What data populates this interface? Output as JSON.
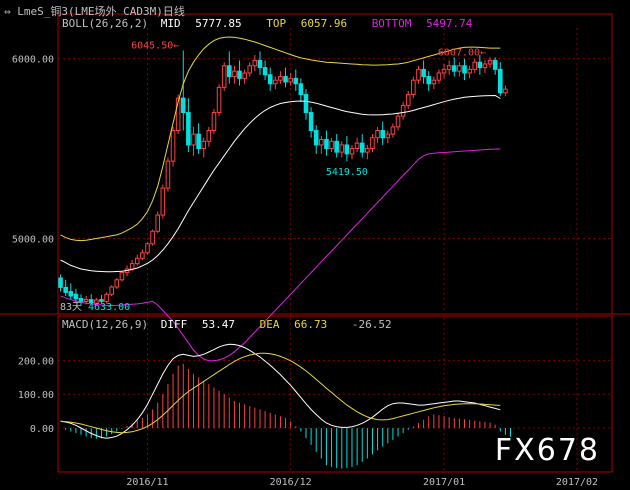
{
  "window": {
    "title": "LmeS_铜3(LME场外 CAD3M)日线",
    "title_color": "#c0c0c0"
  },
  "indicators": {
    "boll": {
      "label": "BOLL(26,26,2)",
      "mid_label": "MID",
      "mid_value": "5777.85",
      "top_label": "TOP",
      "top_value": "6057.96",
      "bottom_label": "BOTTOM",
      "bottom_value": "5497.74"
    },
    "macd": {
      "label": "MACD(12,26,9)",
      "diff_label": "DIFF",
      "diff_value": "53.47",
      "dea_label": "DEA",
      "dea_value": "66.73",
      "macd_value": "-26.52"
    }
  },
  "colors": {
    "up": "#ff4040",
    "down": "#00e0e0",
    "mid": "#ffffff",
    "top": "#e6d83c",
    "bottom": "#e020e0",
    "grid": "#800000",
    "axis": "#b00000",
    "text": "#c0c0c0",
    "annot": "#ff4040",
    "diff": "#ffffff",
    "dea": "#e6d83c"
  },
  "annotations": {
    "high1": "6045.50",
    "high2": "6007.00",
    "low": "5419.50",
    "left_low": "4633.00",
    "day_count": "83天"
  },
  "watermark": "FX678",
  "chart_data": [
    {
      "type": "candlestick",
      "title": "LmeS_铜3(LME场外 CAD3M)日线",
      "y_ticks": [
        "6000.00",
        "5000.00"
      ],
      "y_tick_values": [
        6000,
        5000
      ],
      "ylim": [
        4580,
        6170
      ],
      "x_ticks": [
        "2016/11",
        "2016/12",
        "2017/01",
        "2017/02"
      ],
      "x_tick_index": [
        17,
        45,
        75,
        101
      ],
      "n_bars": 106,
      "candles": [
        [
          4780,
          4800,
          4728,
          4705
        ],
        [
          4728,
          4770,
          4700,
          4680
        ],
        [
          4705,
          4750,
          4680,
          4660
        ],
        [
          4690,
          4720,
          4664,
          4640
        ],
        [
          4666,
          4690,
          4650,
          4630
        ],
        [
          4650,
          4680,
          4661,
          4634
        ],
        [
          4660,
          4690,
          4643,
          4635
        ],
        [
          4640,
          4670,
          4658,
          4633
        ],
        [
          4660,
          4686,
          4650,
          4640
        ],
        [
          4650,
          4700,
          4690,
          4640
        ],
        [
          4690,
          4740,
          4730,
          4680
        ],
        [
          4730,
          4780,
          4770,
          4720
        ],
        [
          4770,
          4820,
          4810,
          4760
        ],
        [
          4810,
          4850,
          4830,
          4790
        ],
        [
          4830,
          4880,
          4860,
          4820
        ],
        [
          4860,
          4910,
          4890,
          4850
        ],
        [
          4890,
          4940,
          4920,
          4880
        ],
        [
          4920,
          4980,
          4970,
          4910
        ],
        [
          4970,
          5050,
          5040,
          4960
        ],
        [
          5040,
          5150,
          5130,
          5030
        ],
        [
          5130,
          5300,
          5280,
          5110
        ],
        [
          5280,
          5450,
          5430,
          5260
        ],
        [
          5430,
          5620,
          5600,
          5400
        ],
        [
          5600,
          5800,
          5780,
          5580
        ],
        [
          5780,
          6045,
          5700,
          5600
        ],
        [
          5700,
          5780,
          5520,
          5480
        ],
        [
          5520,
          5620,
          5580,
          5460
        ],
        [
          5580,
          5640,
          5500,
          5470
        ],
        [
          5500,
          5560,
          5540,
          5450
        ],
        [
          5540,
          5620,
          5600,
          5510
        ],
        [
          5600,
          5720,
          5700,
          5580
        ],
        [
          5700,
          5860,
          5840,
          5680
        ],
        [
          5840,
          5980,
          5960,
          5820
        ],
        [
          5960,
          6040,
          5900,
          5860
        ],
        [
          5900,
          5960,
          5930,
          5860
        ],
        [
          5930,
          5990,
          5890,
          5850
        ],
        [
          5890,
          5940,
          5920,
          5860
        ],
        [
          5920,
          5980,
          5960,
          5900
        ],
        [
          5960,
          6020,
          5990,
          5930
        ],
        [
          5990,
          6040,
          5950,
          5910
        ],
        [
          5950,
          5990,
          5910,
          5880
        ],
        [
          5910,
          5950,
          5860,
          5820
        ],
        [
          5860,
          5900,
          5880,
          5830
        ],
        [
          5880,
          5930,
          5900,
          5860
        ],
        [
          5900,
          5950,
          5870,
          5840
        ],
        [
          5870,
          5920,
          5890,
          5850
        ],
        [
          5890,
          5940,
          5860,
          5820
        ],
        [
          5860,
          5890,
          5800,
          5760
        ],
        [
          5800,
          5830,
          5700,
          5660
        ],
        [
          5700,
          5730,
          5600,
          5560
        ],
        [
          5600,
          5630,
          5520,
          5470
        ],
        [
          5520,
          5570,
          5550,
          5470
        ],
        [
          5550,
          5600,
          5500,
          5460
        ],
        [
          5500,
          5560,
          5540,
          5480
        ],
        [
          5540,
          5580,
          5480,
          5450
        ],
        [
          5480,
          5540,
          5520,
          5450
        ],
        [
          5520,
          5570,
          5470,
          5430
        ],
        [
          5470,
          5520,
          5500,
          5440
        ],
        [
          5500,
          5560,
          5530,
          5480
        ],
        [
          5530,
          5580,
          5480,
          5450
        ],
        [
          5480,
          5520,
          5500,
          5440
        ],
        [
          5500,
          5580,
          5560,
          5480
        ],
        [
          5560,
          5620,
          5600,
          5530
        ],
        [
          5600,
          5650,
          5560,
          5520
        ],
        [
          5560,
          5600,
          5580,
          5530
        ],
        [
          5580,
          5640,
          5620,
          5560
        ],
        [
          5620,
          5700,
          5680,
          5600
        ],
        [
          5680,
          5760,
          5740,
          5660
        ],
        [
          5740,
          5820,
          5800,
          5720
        ],
        [
          5800,
          5900,
          5880,
          5780
        ],
        [
          5880,
          5960,
          5940,
          5860
        ],
        [
          5940,
          5990,
          5900,
          5860
        ],
        [
          5900,
          5930,
          5860,
          5820
        ],
        [
          5860,
          5900,
          5880,
          5830
        ],
        [
          5880,
          5940,
          5920,
          5860
        ],
        [
          5920,
          5970,
          5940,
          5890
        ],
        [
          5940,
          5990,
          5960,
          5910
        ],
        [
          5960,
          6007,
          5930,
          5900
        ],
        [
          5930,
          5980,
          5960,
          5900
        ],
        [
          5960,
          6000,
          5920,
          5880
        ],
        [
          5920,
          5960,
          5940,
          5890
        ],
        [
          5940,
          6000,
          5980,
          5920
        ],
        [
          5980,
          6020,
          5950,
          5910
        ],
        [
          5950,
          5990,
          5970,
          5920
        ],
        [
          5970,
          6007,
          5990,
          5950
        ],
        [
          5990,
          6007,
          5940,
          5910
        ],
        [
          5940,
          5980,
          5810,
          5790
        ],
        [
          5810,
          5850,
          5830,
          5790
        ]
      ],
      "series": [
        {
          "name": "MID",
          "color_key": "mid",
          "values": [
            4880,
            4865,
            4850,
            4840,
            4830,
            4825,
            4820,
            4818,
            4816,
            4815,
            4815,
            4816,
            4818,
            4822,
            4828,
            4836,
            4848,
            4862,
            4880,
            4905,
            4935,
            4970,
            5010,
            5055,
            5105,
            5155,
            5200,
            5245,
            5290,
            5335,
            5380,
            5420,
            5460,
            5500,
            5540,
            5575,
            5610,
            5640,
            5668,
            5692,
            5712,
            5728,
            5740,
            5750,
            5756,
            5760,
            5763,
            5764,
            5762,
            5758,
            5752,
            5744,
            5736,
            5728,
            5720,
            5712,
            5705,
            5700,
            5695,
            5690,
            5688,
            5687,
            5687,
            5688,
            5690,
            5692,
            5696,
            5700,
            5705,
            5712,
            5720,
            5728,
            5736,
            5744,
            5752,
            5760,
            5768,
            5775,
            5780,
            5785,
            5788,
            5790,
            5792,
            5793,
            5794,
            5795,
            5778
          ]
        },
        {
          "name": "TOP",
          "color_key": "top",
          "values": [
            5020,
            5005,
            4995,
            4990,
            4988,
            4990,
            4995,
            5000,
            5005,
            5010,
            5015,
            5020,
            5030,
            5045,
            5060,
            5080,
            5110,
            5150,
            5210,
            5290,
            5400,
            5520,
            5640,
            5760,
            5860,
            5930,
            5980,
            6020,
            6055,
            6080,
            6100,
            6112,
            6118,
            6120,
            6118,
            6114,
            6108,
            6100,
            6092,
            6082,
            6072,
            6062,
            6052,
            6042,
            6032,
            6022,
            6012,
            6004,
            5998,
            5992,
            5988,
            5984,
            5980,
            5978,
            5976,
            5974,
            5972,
            5970,
            5968,
            5966,
            5965,
            5964,
            5964,
            5965,
            5966,
            5968,
            5970,
            5974,
            5980,
            5988,
            5996,
            6004,
            6012,
            6020,
            6028,
            6036,
            6044,
            6052,
            6058,
            6062,
            6064,
            6064,
            6062,
            6060,
            6058,
            6058,
            6058
          ]
        },
        {
          "name": "BOTTOM",
          "color_key": "bottom",
          "values": [
            4680,
            4670,
            4660,
            4652,
            4645,
            4640,
            4636,
            4633,
            4630,
            4628,
            4627,
            4628,
            4630,
            4632,
            4634,
            4636,
            4640,
            4645,
            4650,
            4630,
            4600,
            4570,
            4540,
            4500,
            4460,
            4420,
            4380,
            4350,
            4330,
            4320,
            4320,
            4325,
            4335,
            4350,
            4370,
            4395,
            4420,
            4450,
            4480,
            4510,
            4540,
            4570,
            4600,
            4630,
            4660,
            4690,
            4720,
            4750,
            4780,
            4810,
            4840,
            4870,
            4900,
            4930,
            4960,
            4990,
            5020,
            5050,
            5080,
            5110,
            5140,
            5170,
            5200,
            5230,
            5260,
            5290,
            5320,
            5350,
            5380,
            5410,
            5440,
            5460,
            5470,
            5474,
            5476,
            5478,
            5480,
            5482,
            5484,
            5486,
            5488,
            5490,
            5492,
            5494,
            5496,
            5497,
            5498
          ]
        }
      ]
    },
    {
      "type": "bar+line",
      "title": "MACD(12,26,9)",
      "y_ticks": [
        "200.00",
        "100.00",
        "0.00"
      ],
      "y_tick_values": [
        200,
        100,
        0
      ],
      "ylim": [
        -130,
        290
      ],
      "n_bars": 106,
      "macd_values": [
        0,
        -5,
        -10,
        -15,
        -20,
        -25,
        -30,
        -32,
        -30,
        -25,
        -18,
        -10,
        -2,
        6,
        14,
        22,
        30,
        40,
        55,
        75,
        100,
        130,
        160,
        185,
        190,
        175,
        160,
        150,
        140,
        130,
        120,
        110,
        100,
        90,
        80,
        75,
        70,
        65,
        60,
        55,
        50,
        45,
        40,
        35,
        30,
        20,
        5,
        -10,
        -30,
        -50,
        -70,
        -90,
        -110,
        -115,
        -118,
        -120,
        -118,
        -115,
        -110,
        -100,
        -90,
        -78,
        -66,
        -55,
        -45,
        -35,
        -25,
        -15,
        -5,
        5,
        15,
        25,
        35,
        40,
        38,
        35,
        32,
        30,
        28,
        26,
        24,
        22,
        20,
        18,
        16,
        10,
        -10,
        -20,
        -26
      ],
      "series": [
        {
          "name": "DIFF",
          "color_key": "diff",
          "values": [
            20,
            18,
            14,
            8,
            0,
            -8,
            -16,
            -22,
            -28,
            -30,
            -28,
            -24,
            -16,
            -5,
            8,
            25,
            45,
            70,
            100,
            130,
            160,
            185,
            205,
            215,
            218,
            215,
            212,
            214,
            218,
            225,
            232,
            240,
            245,
            248,
            247,
            244,
            238,
            230,
            220,
            210,
            198,
            186,
            172,
            158,
            142,
            126,
            108,
            90,
            72,
            55,
            40,
            26,
            15,
            8,
            4,
            2,
            2,
            4,
            8,
            14,
            22,
            32,
            44,
            56,
            66,
            72,
            74,
            74,
            72,
            70,
            68,
            68,
            70,
            72,
            74,
            76,
            78,
            80,
            80,
            78,
            76,
            74,
            70,
            66,
            62,
            58,
            54
          ]
        },
        {
          "name": "DEA",
          "color_key": "dea",
          "values": [
            20,
            19,
            17,
            15,
            12,
            8,
            4,
            0,
            -4,
            -8,
            -11,
            -13,
            -14,
            -13,
            -11,
            -7,
            -2,
            5,
            14,
            25,
            38,
            52,
            67,
            82,
            96,
            108,
            118,
            128,
            138,
            148,
            158,
            168,
            178,
            188,
            197,
            205,
            211,
            216,
            219,
            221,
            221,
            220,
            217,
            212,
            206,
            199,
            190,
            180,
            169,
            157,
            144,
            131,
            118,
            105,
            92,
            80,
            68,
            58,
            48,
            40,
            33,
            28,
            25,
            24,
            25,
            28,
            32,
            36,
            40,
            44,
            48,
            52,
            56,
            60,
            63,
            66,
            68,
            70,
            71,
            72,
            72,
            72,
            71,
            70,
            69,
            68,
            67
          ]
        }
      ]
    }
  ]
}
